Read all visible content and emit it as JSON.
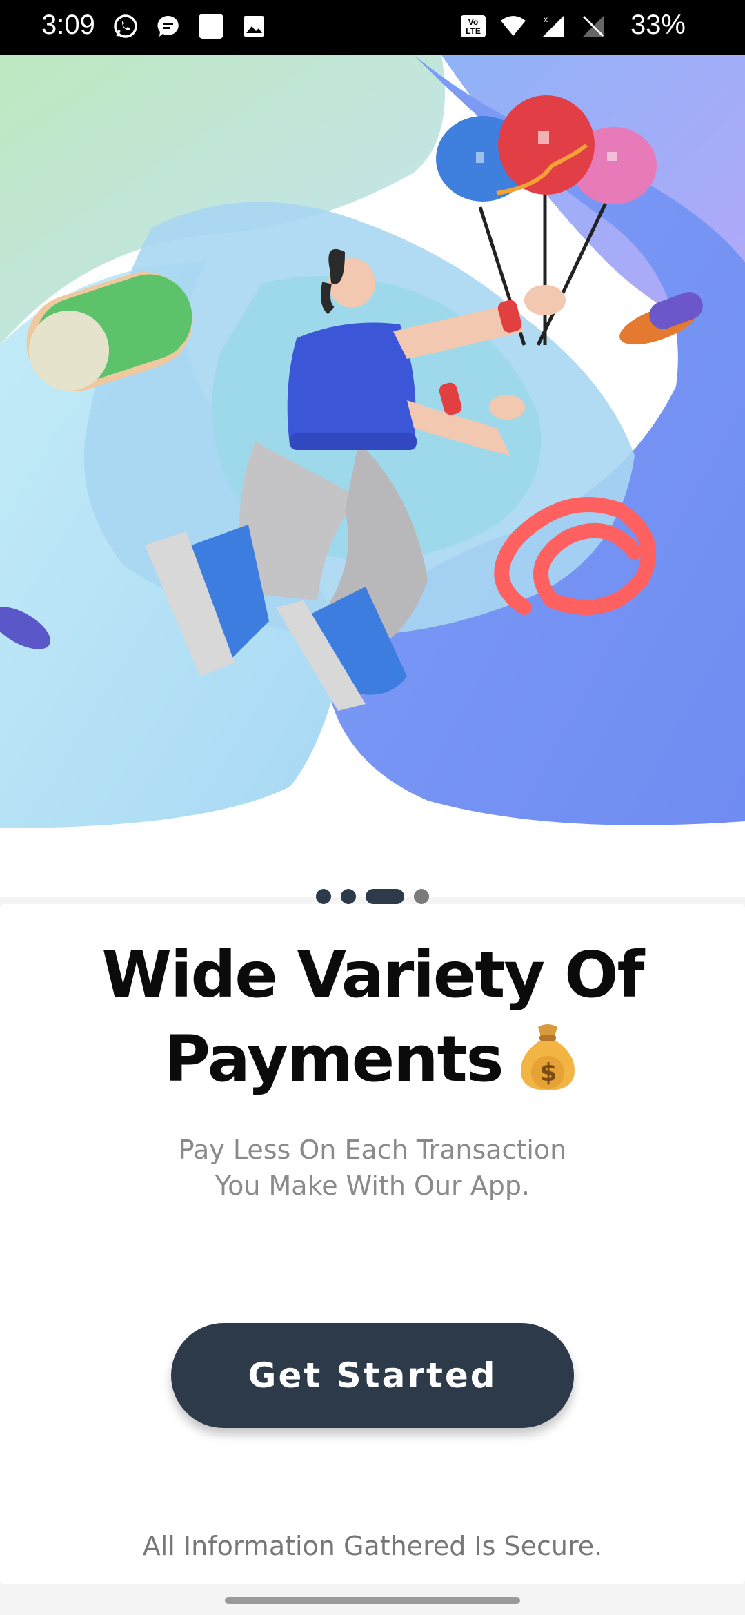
{
  "status_bar": {
    "time": "3:09",
    "battery": "33%",
    "left_icons": [
      "whatsapp-icon",
      "messages-icon",
      "square-icon",
      "gallery-icon"
    ],
    "right_icons": [
      "volte-icon",
      "wifi-icon",
      "signal-icon",
      "no-sim-icon"
    ]
  },
  "hero": {
    "illustration": "person-with-balloons-illustration"
  },
  "pager": {
    "count": 4,
    "active_index": 2
  },
  "onboarding": {
    "title_line1": "Wide Variety Of",
    "title_line2": "Payments",
    "title_emoji": "money-bag-icon",
    "subtitle_line1": "Pay Less On Each Transaction",
    "subtitle_line2": "You Make With Our App.",
    "cta_label": "Get Started",
    "footer_note": "All Information Gathered Is Secure."
  },
  "colors": {
    "primary": "#2d3a4a",
    "title": "#0b0b0b",
    "muted": "#8a8a8a"
  }
}
